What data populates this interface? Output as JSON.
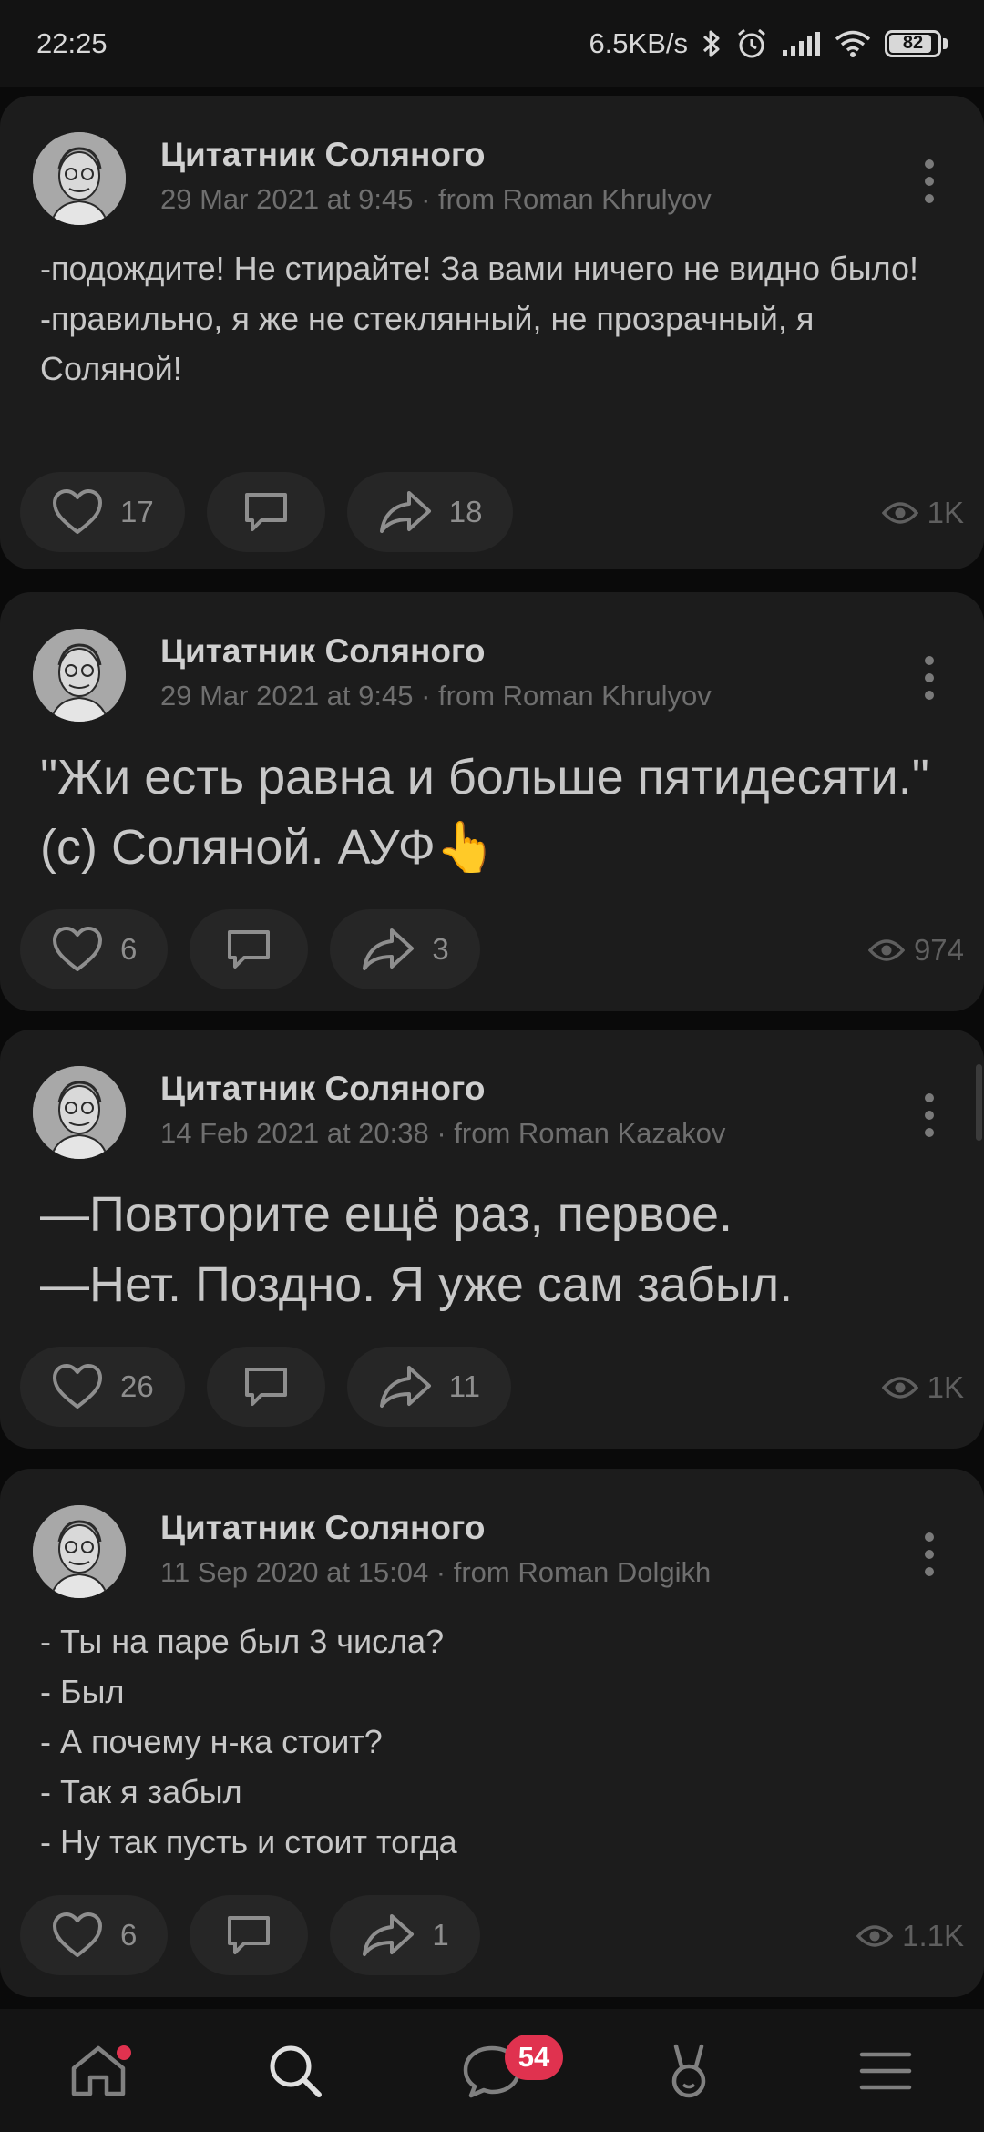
{
  "status_bar": {
    "time": "22:25",
    "network_speed": "6.5KB/s",
    "battery_level": "82",
    "battery_fraction": 0.82,
    "icons": [
      "bluetooth-icon",
      "alarm-icon",
      "signal-icon",
      "wifi-icon",
      "battery-icon"
    ]
  },
  "posts": [
    {
      "author": "Цитатник Соляного",
      "meta": "29 Mar 2021 at 9:45 · from Roman Khrulyov",
      "text": "-подождите! Не стирайте! За вами ничего не видно было!\n-правильно, я же не стеклянный, не прозрачный, я Соляной!",
      "likes": "17",
      "shares": "18",
      "views": "1K"
    },
    {
      "author": "Цитатник Соляного",
      "meta": "29 Mar 2021 at 9:45 · from Roman Khrulyov",
      "text": "\"Жи есть равна и больше пятидесяти.\" (с) Соляной. АУФ👆",
      "likes": "6",
      "shares": "3",
      "views": "974"
    },
    {
      "author": "Цитатник Соляного",
      "meta": "14 Feb 2021 at 20:38 · from Roman Kazakov",
      "text": "—Повторите ещё раз, первое.\n—Нет. Поздно. Я уже сам забыл.",
      "likes": "26",
      "shares": "11",
      "views": "1K"
    },
    {
      "author": "Цитатник Соляного",
      "meta": "11 Sep 2020 at 15:04 · from Roman Dolgikh",
      "text": "- Ты на паре был 3 числа?\n- Был\n- А почему н-ка стоит?\n- Так я забыл\n- Ну так пусть и стоит тогда",
      "likes": "6",
      "shares": "1",
      "views": "1.1K"
    }
  ],
  "bottom_nav": {
    "items": [
      "home-icon",
      "search-icon",
      "messages-icon",
      "services-icon",
      "menu-icon"
    ],
    "messages_badge": "54",
    "accent_color": "#e0324f"
  }
}
